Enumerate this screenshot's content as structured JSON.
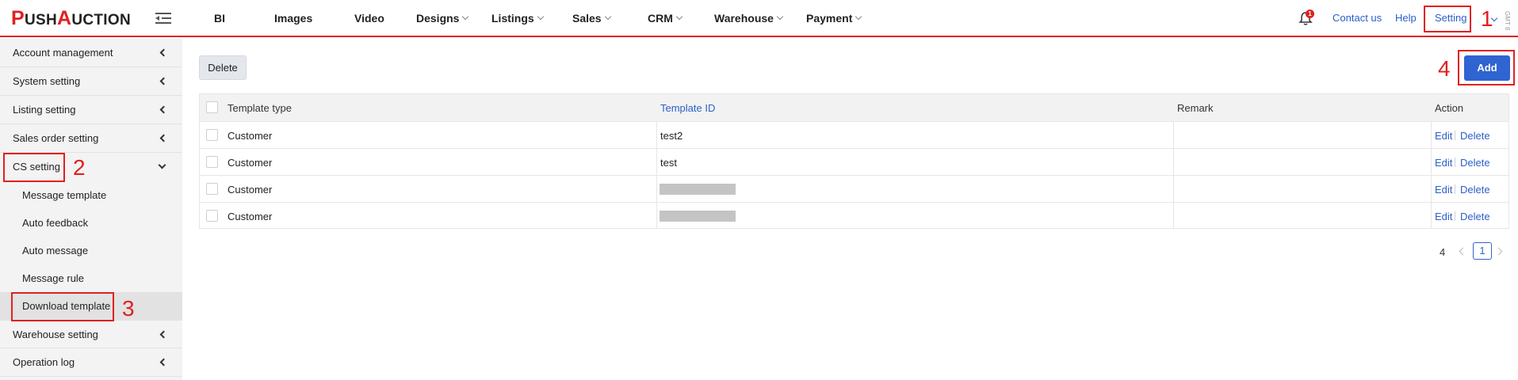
{
  "brand": {
    "logo_p": "P",
    "logo_ush": "USH",
    "logo_a": "A",
    "logo_uction": "UCTION"
  },
  "nav": {
    "items": [
      {
        "label": "BI",
        "dropdown": false
      },
      {
        "label": "Images",
        "dropdown": false
      },
      {
        "label": "Video",
        "dropdown": false
      },
      {
        "label": "Designs",
        "dropdown": true
      },
      {
        "label": "Listings",
        "dropdown": true
      },
      {
        "label": "Sales",
        "dropdown": true
      },
      {
        "label": "CRM",
        "dropdown": true
      },
      {
        "label": "Warehouse",
        "dropdown": true
      },
      {
        "label": "Payment",
        "dropdown": true
      }
    ],
    "notification_count": "1",
    "contact_us": "Contact us",
    "help": "Help",
    "setting": "Setting",
    "timezone": "GMT 8"
  },
  "annotations": {
    "n1": "1",
    "n2": "2",
    "n3": "3",
    "n4": "4"
  },
  "sidebar": {
    "items": [
      {
        "label": "Account management",
        "expanded": false
      },
      {
        "label": "System setting",
        "expanded": false
      },
      {
        "label": "Listing setting",
        "expanded": false
      },
      {
        "label": "Sales order setting",
        "expanded": false
      },
      {
        "label": "CS setting",
        "expanded": true
      },
      {
        "label": "Warehouse setting",
        "expanded": false
      },
      {
        "label": "Operation log",
        "expanded": false
      }
    ],
    "cs_subitems": [
      {
        "label": "Message template",
        "active": false
      },
      {
        "label": "Auto feedback",
        "active": false
      },
      {
        "label": "Auto message",
        "active": false
      },
      {
        "label": "Message rule",
        "active": false
      },
      {
        "label": "Download template",
        "active": true
      }
    ]
  },
  "toolbar": {
    "delete_label": "Delete",
    "add_label": "Add"
  },
  "table": {
    "columns": [
      "Template type",
      "Template ID",
      "Remark",
      "Action"
    ],
    "rows": [
      {
        "type": "Customer",
        "template_id": "test2",
        "remark": "",
        "redacted": false
      },
      {
        "type": "Customer",
        "template_id": "test",
        "remark": "",
        "redacted": false
      },
      {
        "type": "Customer",
        "template_id": "",
        "remark": "",
        "redacted": true
      },
      {
        "type": "Customer",
        "template_id": "",
        "remark": "",
        "redacted": true
      }
    ],
    "action_edit": "Edit",
    "action_delete": "Delete"
  },
  "pagination": {
    "total": "4",
    "current_page": "1"
  },
  "colors": {
    "accent_red": "#e02020",
    "primary_blue": "#2f64d1",
    "link_blue": "#2b5fc9"
  }
}
